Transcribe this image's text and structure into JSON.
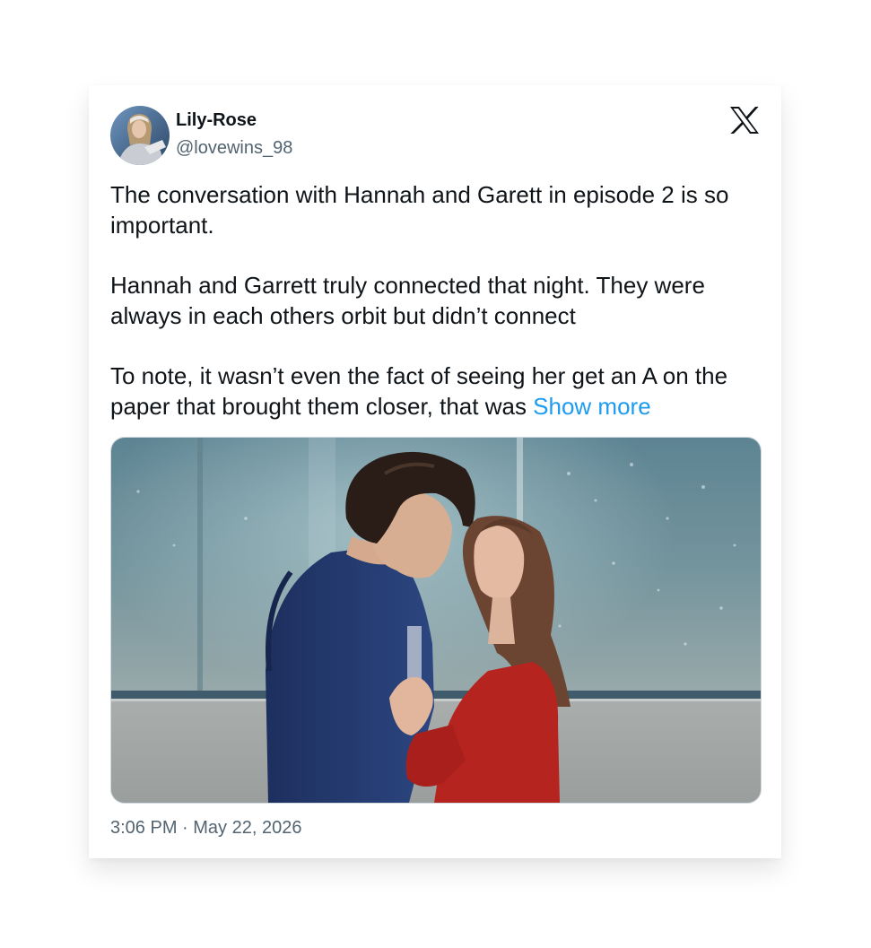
{
  "tweet": {
    "author_name": "Lily-Rose",
    "handle": "@lovewins_98",
    "brand_icon": "x-logo-icon",
    "paragraphs": [
      "The conversation with Hannah and Garett in episode 2 is so important.",
      "Hannah and Garrett truly connected that night. They were always in each others orbit but didn’t connect",
      "To note, it wasn’t even the fact of seeing her get an A on the paper that brought them closer, that was"
    ],
    "show_more": "Show more",
    "timestamp": "3:06 PM · May 22, 2026"
  },
  "colors": {
    "text": "#0f1419",
    "secondary_text": "#536471",
    "link": "#1d9bf0"
  }
}
